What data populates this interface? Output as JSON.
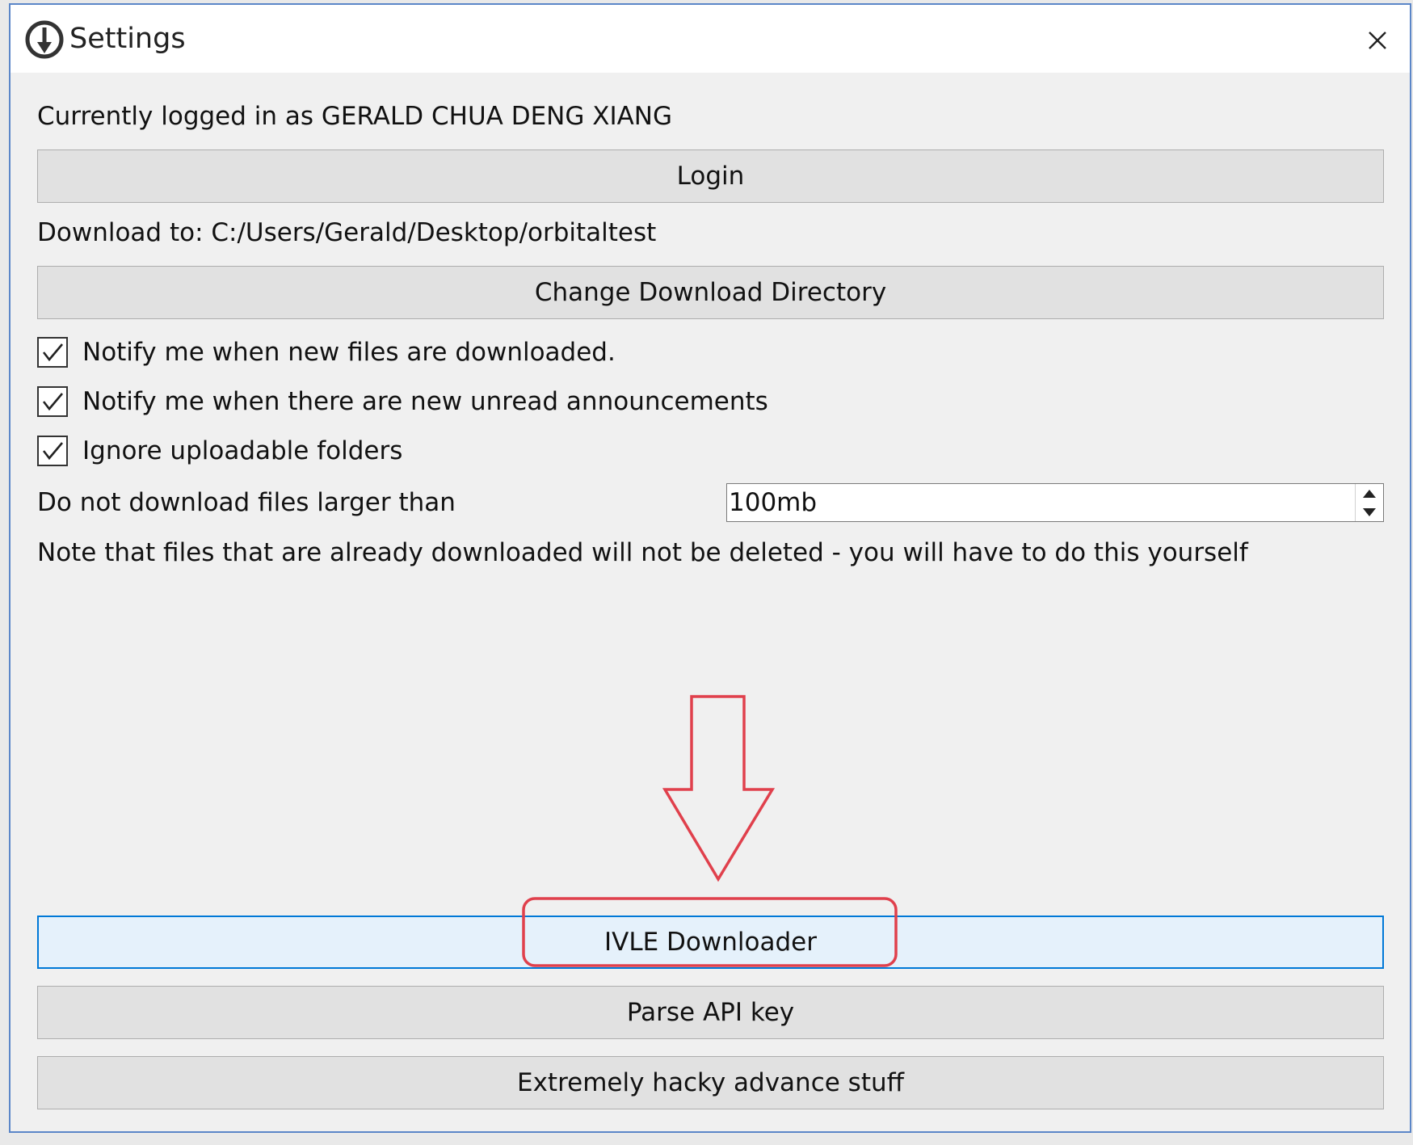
{
  "window": {
    "title": "Settings",
    "close_icon": "close-icon",
    "app_icon": "download-logo-icon"
  },
  "account": {
    "status_text": "Currently logged in as GERALD CHUA DENG XIANG",
    "login_label": "Login"
  },
  "download": {
    "path_text": "Download to: C:/Users/Gerald/Desktop/orbitaltest",
    "change_dir_label": "Change Download Directory"
  },
  "options": [
    {
      "label": "Notify me when new files are downloaded.",
      "checked": true
    },
    {
      "label": "Notify me when there are new unread announcements",
      "checked": true
    },
    {
      "label": "Ignore uploadable folders",
      "checked": true
    }
  ],
  "size_limit": {
    "label": "Do not download files larger than",
    "value": "100mb"
  },
  "note": "Note that files that are already downloaded will not be deleted - you will have to do this yourself",
  "bottom_buttons": {
    "ivle_label": "IVLE Downloader",
    "parse_label": "Parse API key",
    "advanced_label": "Extremely hacky advance stuff"
  },
  "colors": {
    "annotation": "#e0404c",
    "focus": "#0078d7",
    "window_border": "#5b86c8"
  }
}
